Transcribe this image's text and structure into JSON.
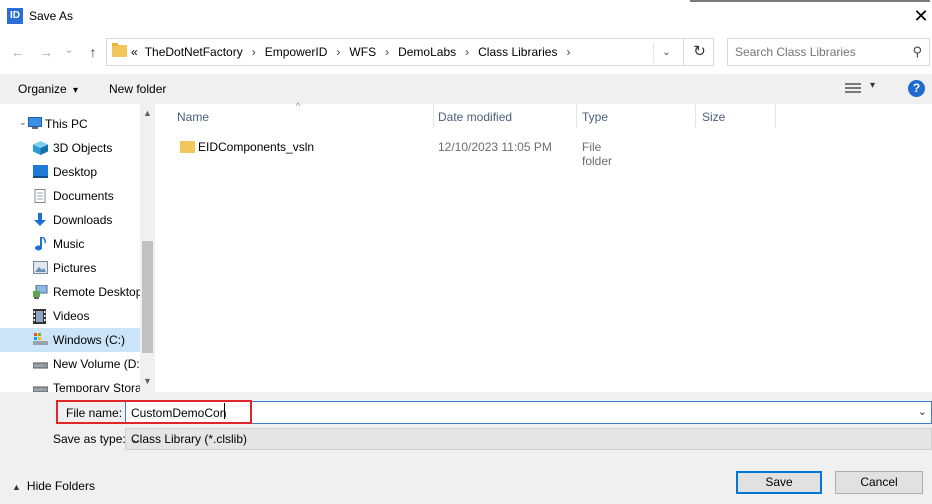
{
  "window": {
    "title": "Save As",
    "app_icon_text": "ID",
    "close_glyph": "✕"
  },
  "nav": {
    "back_glyph": "←",
    "forward_glyph": "→",
    "recent_glyph": "⌄",
    "up_glyph": "↑",
    "breadcrumb_overflow": "«",
    "breadcrumbs": [
      "TheDotNetFactory",
      "EmpowerID",
      "WFS",
      "DemoLabs",
      "Class Libraries"
    ],
    "crumb_separator": "›",
    "refresh_glyph": "↻",
    "search_placeholder": "Search Class Libraries",
    "search_glyph": "⚲"
  },
  "toolbar": {
    "organize_label": "Organize",
    "organize_caret": "▾",
    "new_folder_label": "New folder",
    "help_glyph": "?",
    "view_caret": "▾"
  },
  "sidebar": {
    "items": [
      {
        "label": "This PC",
        "icon": "computer-icon"
      },
      {
        "label": "3D Objects",
        "icon": "cube-icon"
      },
      {
        "label": "Desktop",
        "icon": "desktop-icon"
      },
      {
        "label": "Documents",
        "icon": "documents-icon"
      },
      {
        "label": "Downloads",
        "icon": "downloads-icon"
      },
      {
        "label": "Music",
        "icon": "music-icon"
      },
      {
        "label": "Pictures",
        "icon": "pictures-icon"
      },
      {
        "label": "Remote Desktop",
        "icon": "remote-desktop-icon"
      },
      {
        "label": "Videos",
        "icon": "videos-icon"
      },
      {
        "label": "Windows (C:)",
        "icon": "drive-c-icon",
        "selected": true
      },
      {
        "label": "New Volume (D:",
        "icon": "drive-d-icon"
      },
      {
        "label": "Temporary Stora",
        "icon": "drive-temp-icon"
      }
    ],
    "collapse_glyph": "⌄",
    "scroll_up_glyph": "▲",
    "scroll_down_glyph": "▼"
  },
  "filelist": {
    "columns": [
      "Name",
      "Date modified",
      "Type",
      "Size"
    ],
    "sort_glyph": "^",
    "rows": [
      {
        "name": "EIDComponents_vsln",
        "date": "12/10/2023 11:05 PM",
        "type": "File folder",
        "size": ""
      }
    ]
  },
  "bottom": {
    "file_name_label": "File name:",
    "file_name_value": "CustomDemoCon",
    "save_as_type_label": "Save as type:",
    "save_as_type_value": "Class Library (*.clslib)",
    "dropdown_glyph": "⌄",
    "hide_folders_label": "Hide Folders",
    "hide_folders_glyph": "▲",
    "save_label": "Save",
    "cancel_label": "Cancel"
  },
  "colors": {
    "accent": "#0078d7",
    "highlight_box": "#e0252b",
    "selected_bg": "#cce4f7",
    "folder": "#f2c65b"
  }
}
